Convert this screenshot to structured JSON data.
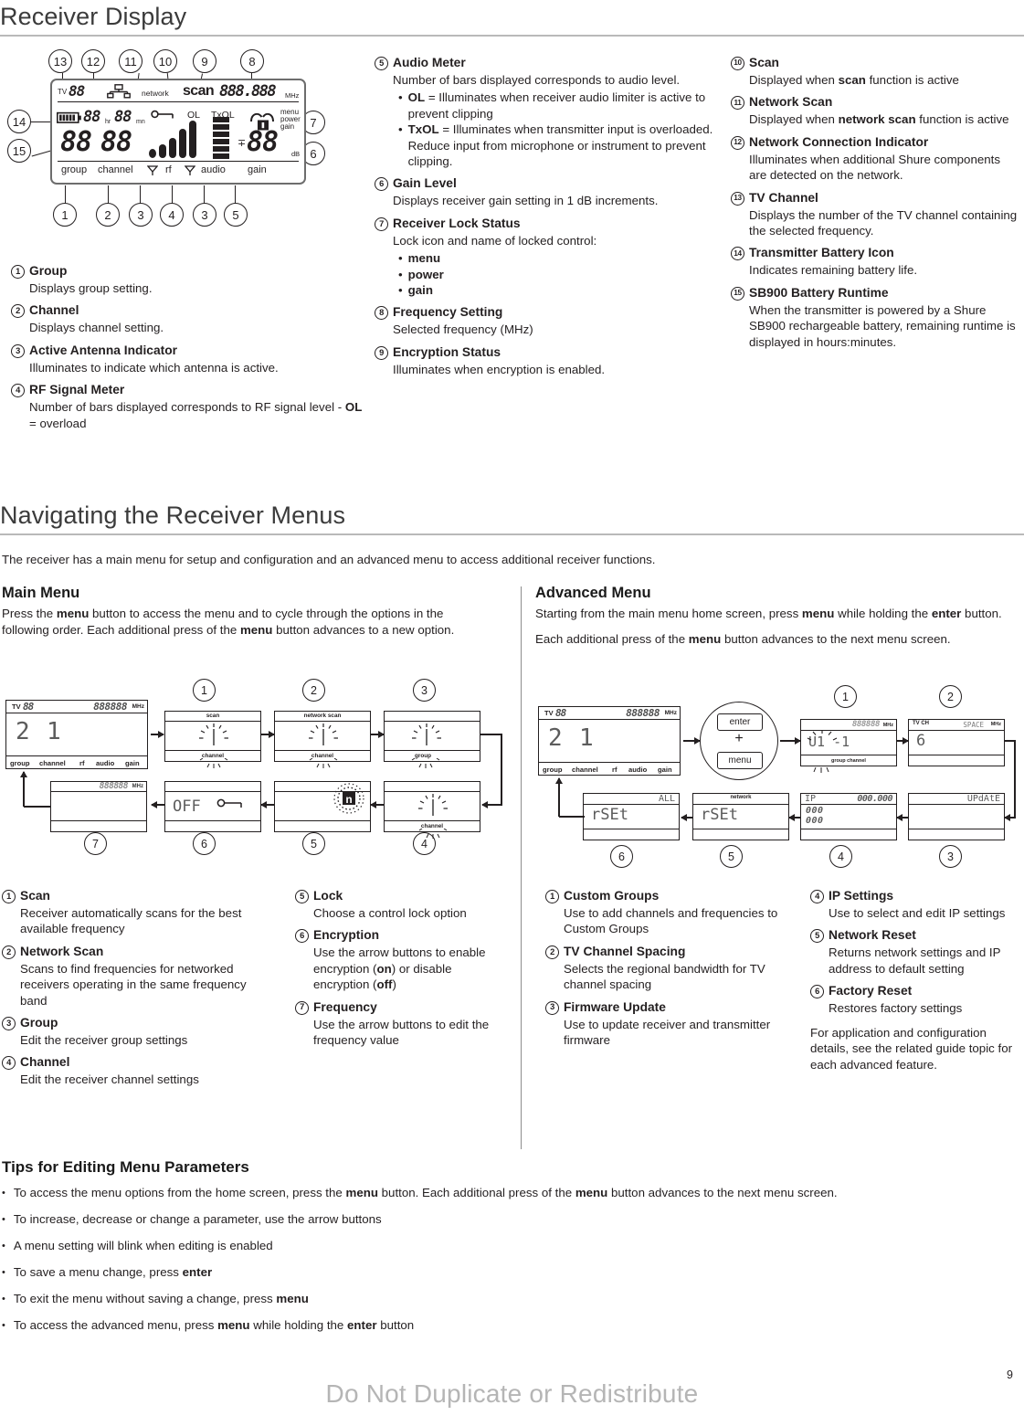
{
  "section1": {
    "title": "Receiver Display",
    "display_labels": {
      "tv": "TV",
      "network": "network",
      "scan": "scan",
      "freq": "888.888",
      "mhz": "MHz",
      "hr": "hr",
      "mn": "mn",
      "digits": "88",
      "ol": "OL",
      "txol": "TxOL",
      "menu": "menu",
      "power": "power",
      "gain_lock": "gain",
      "db": "dB",
      "group": "group",
      "channel": "channel",
      "rf": "rf",
      "audio": "audio",
      "gain": "gain"
    },
    "callout_numbers": [
      "1",
      "2",
      "3",
      "4",
      "5",
      "6",
      "7",
      "8",
      "9",
      "10",
      "11",
      "12",
      "13",
      "14",
      "15"
    ],
    "items_col1": [
      {
        "num": "1",
        "title": "Group",
        "desc": "Displays group setting."
      },
      {
        "num": "2",
        "title": "Channel",
        "desc": "Displays channel setting."
      },
      {
        "num": "3",
        "title": "Active Antenna Indicator",
        "desc": "Illuminates to indicate which antenna is active."
      },
      {
        "num": "4",
        "title": "RF Signal Meter",
        "desc": "Number of bars displayed corresponds to RF signal level - OL = overload",
        "desc_pre": "Number of bars displayed corresponds to RF signal level - ",
        "desc_bold": "OL",
        "desc_post": " = overload"
      }
    ],
    "items_col2": [
      {
        "num": "5",
        "title": "Audio Meter",
        "desc": "Number of bars displayed corresponds to audio level.",
        "bullets": [
          {
            "bold": "OL",
            "text": " = Illuminates when receiver audio limiter is active to prevent clipping"
          },
          {
            "bold": "TxOL",
            "text": " = Illuminates when transmitter input is overloaded. Reduce input from microphone or instrument to prevent clipping."
          }
        ]
      },
      {
        "num": "6",
        "title": "Gain Level",
        "desc": "Displays receiver gain setting in 1 dB increments."
      },
      {
        "num": "7",
        "title": "Receiver Lock Status",
        "desc": "Lock icon and name of locked control:",
        "bullets": [
          {
            "bold": "menu",
            "text": ""
          },
          {
            "bold": "power",
            "text": ""
          },
          {
            "bold": "gain",
            "text": ""
          }
        ]
      },
      {
        "num": "8",
        "title": "Frequency Setting",
        "desc": "Selected frequency (MHz)"
      },
      {
        "num": "9",
        "title": "Encryption Status",
        "desc": "Illuminates when encryption is enabled."
      }
    ],
    "items_col3": [
      {
        "num": "10",
        "title": "Scan",
        "desc_pre": "Displayed when ",
        "desc_bold": "scan",
        "desc_post": " function is active"
      },
      {
        "num": "11",
        "title": "Network Scan",
        "desc_pre": "Displayed when ",
        "desc_bold": "network scan",
        "desc_post": " function is active"
      },
      {
        "num": "12",
        "title": "Network Connection Indicator",
        "desc": "Illuminates when additional Shure components are detected on the network."
      },
      {
        "num": "13",
        "title": "TV Channel",
        "desc": "Displays the number of the TV channel containing the selected frequency."
      },
      {
        "num": "14",
        "title": "Transmitter Battery Icon",
        "desc": "Indicates remaining battery life."
      },
      {
        "num": "15",
        "title": "SB900 Battery Runtime",
        "desc": "When the transmitter is powered by a Shure SB900 rechargeable battery, remaining runtime is displayed in hours:minutes."
      }
    ]
  },
  "section2": {
    "title": "Navigating the Receiver Menus",
    "intro": "The receiver has a main menu for setup and configuration and an advanced menu to access additional receiver functions.",
    "main_menu": {
      "heading": "Main Menu",
      "intro_1": "Press the ",
      "intro_b1": "menu",
      "intro_2": " button to access the menu and to cycle through the options in the following order. Each additional press of the ",
      "intro_b2": "menu",
      "intro_3": " button advances to a new option.",
      "home_screen": {
        "tv": "TV",
        "tv_val": "88",
        "freq": "888888",
        "mhz": "MHz",
        "group_val": "2",
        "channel_val": "1",
        "labels": [
          "group",
          "channel",
          "rf",
          "audio",
          "gain"
        ]
      },
      "screens": [
        {
          "num": "1",
          "top_label": "scan",
          "bottom_label": "channel"
        },
        {
          "num": "2",
          "top_label": "network scan",
          "bottom_label": "channel"
        },
        {
          "num": "3",
          "top_label": "",
          "bottom_label": "group"
        },
        {
          "num": "4",
          "top_label": "",
          "bottom_label": "channel"
        },
        {
          "num": "5",
          "top_label": "",
          "bottom_label": "",
          "icon": "encryption-n-icon"
        },
        {
          "num": "6",
          "top_label": "",
          "bottom_label": "",
          "value": "OFF",
          "icon": "lock-key-icon"
        },
        {
          "num": "7",
          "top_label": "888888",
          "mhz": "MHz",
          "bottom_label": ""
        }
      ],
      "items_left": [
        {
          "num": "1",
          "title": "Scan",
          "desc": "Receiver automatically scans for the best available frequency"
        },
        {
          "num": "2",
          "title": "Network Scan",
          "desc": "Scans to find frequencies for networked receivers operating in the same frequency band"
        },
        {
          "num": "3",
          "title": "Group",
          "desc": "Edit the receiver group settings"
        },
        {
          "num": "4",
          "title": "Channel",
          "desc": "Edit the receiver channel settings"
        }
      ],
      "items_right": [
        {
          "num": "5",
          "title": "Lock",
          "desc": "Choose a control lock option"
        },
        {
          "num": "6",
          "title": "Encryption",
          "desc_pre": "Use the arrow buttons to enable encryption (",
          "desc_b1": "on",
          "desc_mid": ") or disable encryption (",
          "desc_b2": "off",
          "desc_post": ")"
        },
        {
          "num": "7",
          "title": "Frequency",
          "desc": "Use the arrow buttons to edit the frequency value"
        }
      ]
    },
    "advanced_menu": {
      "heading": "Advanced Menu",
      "intro_1": "Starting from the main menu home screen, press ",
      "intro_b1": "menu",
      "intro_2": " while holding the ",
      "intro_b2": "enter",
      "intro_3": " button.",
      "intro2_1": "Each additional press of the ",
      "intro2_b": "menu",
      "intro2_2": " button advances to the next menu screen.",
      "combo": {
        "enter": "enter",
        "plus": "+",
        "menu": "menu"
      },
      "home_screen": {
        "tv": "TV",
        "tv_val": "88",
        "freq": "888888",
        "mhz": "MHz",
        "group_val": "2",
        "channel_val": "1",
        "labels": [
          "group",
          "channel",
          "rf",
          "audio",
          "gain"
        ]
      },
      "screens": [
        {
          "num": "1",
          "top_right": "888888",
          "mhz": "MHz",
          "value": "U1 -1",
          "bottom_label": "group  channel"
        },
        {
          "num": "2",
          "top_left": "TV CH",
          "top_right": "SPACE",
          "mhz": "MHz",
          "value": "6"
        },
        {
          "num": "3",
          "top_right": "UPdAtE"
        },
        {
          "num": "4",
          "top_left": "IP",
          "top_right": "000.000",
          "value_1": "000",
          "value_2": "000"
        },
        {
          "num": "5",
          "top_label": "network",
          "value": "rSEt"
        },
        {
          "num": "6",
          "top_right": "ALL",
          "value": "rSEt"
        }
      ],
      "items_left": [
        {
          "num": "1",
          "title": "Custom Groups",
          "desc": "Use to add channels and frequencies to Custom Groups"
        },
        {
          "num": "2",
          "title": "TV Channel Spacing",
          "desc": "Selects the regional bandwidth for TV channel spacing"
        },
        {
          "num": "3",
          "title": "Firmware Update",
          "desc": "Use to update receiver and transmitter firmware"
        }
      ],
      "items_right": [
        {
          "num": "4",
          "title": "IP Settings",
          "desc": "Use to select and edit IP settings"
        },
        {
          "num": "5",
          "title": "Network Reset",
          "desc": "Returns network settings and IP address to default setting"
        },
        {
          "num": "6",
          "title": "Factory Reset",
          "desc": "Restores factory settings"
        }
      ],
      "footnote": "For application and configuration details, see the related guide topic for each advanced feature."
    }
  },
  "tips": {
    "heading": "Tips for Editing Menu Parameters",
    "items": [
      {
        "pre": "To access the menu options from the home screen, press the ",
        "b1": "menu",
        "mid": " button. Each additional press of the ",
        "b2": "menu",
        "post": " button advances to the next menu screen."
      },
      {
        "pre": "To increase, decrease or change a parameter, use the arrow buttons",
        "b1": "",
        "mid": "",
        "b2": "",
        "post": ""
      },
      {
        "pre": "A menu setting will blink when editing is enabled",
        "b1": "",
        "mid": "",
        "b2": "",
        "post": ""
      },
      {
        "pre": "To save a menu change, press ",
        "b1": "enter",
        "mid": "",
        "b2": "",
        "post": ""
      },
      {
        "pre": "To exit the menu without saving a change, press ",
        "b1": "menu",
        "mid": "",
        "b2": "",
        "post": ""
      },
      {
        "pre": "To access the advanced menu, press ",
        "b1": "menu",
        "mid": " while holding the ",
        "b2": "enter",
        "post": " button"
      }
    ]
  },
  "footer": {
    "watermark": "Do Not Duplicate or Redistribute",
    "page_number": "9"
  }
}
